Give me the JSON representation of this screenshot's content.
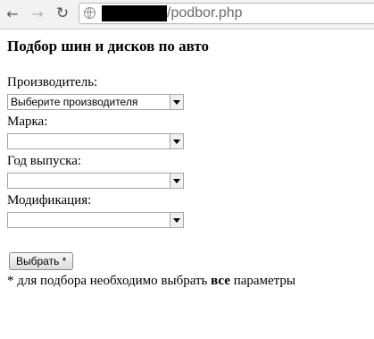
{
  "browser": {
    "url_path": "/podbor.php"
  },
  "page": {
    "title": "Подбор шин и дисков по авто",
    "fields": [
      {
        "label": "Производитель:",
        "value": "Выберите производителя"
      },
      {
        "label": "Марка:",
        "value": ""
      },
      {
        "label": "Год выпуска:",
        "value": ""
      },
      {
        "label": "Модификация:",
        "value": ""
      }
    ],
    "submit_label": "Выбрать *",
    "note_prefix": "* для подбора необходимо выбрать ",
    "note_bold": "все",
    "note_suffix": " параметры"
  }
}
